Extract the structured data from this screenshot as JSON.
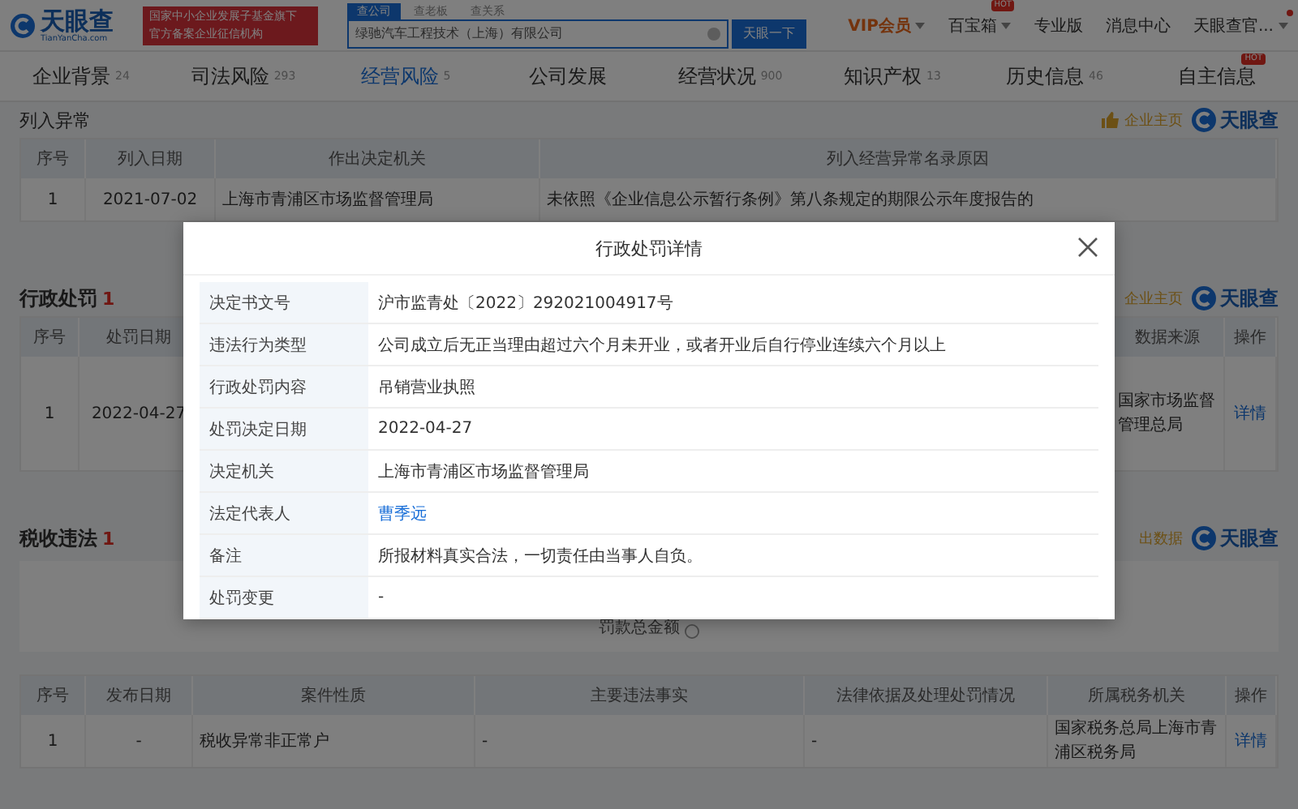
{
  "header": {
    "logo_text": "天眼查",
    "logo_domain": "TianYanCha.com",
    "banner_lines": [
      "国家中小企业发展子基金旗下",
      "官方备案企业征信机构"
    ],
    "search_tabs": [
      {
        "label": "查公司",
        "selected": true
      },
      {
        "label": "查老板",
        "selected": false
      },
      {
        "label": "查关系",
        "selected": false
      }
    ],
    "search_value": "绿驰汽车工程技术（上海）有限公司",
    "search_button": "天眼一下",
    "nav": [
      {
        "label": "VIP会员",
        "kind": "vip",
        "caret": true,
        "dot": false
      },
      {
        "label": "百宝箱",
        "kind": "plain",
        "caret": true,
        "badge": "HOT",
        "dot": false
      },
      {
        "label": "专业版",
        "kind": "plain",
        "caret": false,
        "dot": false
      },
      {
        "label": "消息中心",
        "kind": "plain",
        "caret": false,
        "dot": false
      },
      {
        "label": "天眼查官...",
        "kind": "plain",
        "caret": true,
        "dot": true
      }
    ]
  },
  "tabs": [
    {
      "label": "企业背景",
      "count": "24",
      "selected": false
    },
    {
      "label": "司法风险",
      "count": "293",
      "selected": false
    },
    {
      "label": "经营风险",
      "count": "5",
      "selected": true
    },
    {
      "label": "公司发展",
      "selected": false
    },
    {
      "label": "经营状况",
      "count": "900",
      "selected": false
    },
    {
      "label": "知识产权",
      "count": "13",
      "selected": false
    },
    {
      "label": "历史信息",
      "count": "46",
      "selected": false
    },
    {
      "label": "自主信息",
      "badge": "HOT",
      "selected": false
    }
  ],
  "sections": [
    {
      "title": "列入异常",
      "tool": {
        "kind": "like",
        "label": "企业主页"
      },
      "brand": "天眼查",
      "table": {
        "action_column": false,
        "columns": [
          "序号",
          "列入日期",
          "作出决定机关",
          "列入经营异常名录原因"
        ],
        "rows": [
          [
            "1",
            "2021-07-02",
            "上海市青浦区市场监督管理局",
            "未依照《企业信息公示暂行条例》第八条规定的期限公示年度报告的"
          ]
        ]
      }
    },
    {
      "title": "行政处罚",
      "count": "1",
      "tool": {
        "kind": "plain",
        "label": "企业主页"
      },
      "brand": "天眼查",
      "table": {
        "action_column": true,
        "columns": [
          "序号",
          "处罚日期",
          "数据来源",
          "操作"
        ],
        "rows": [
          [
            "1",
            "2022-04-27",
            "国家市场监督管理总局",
            "详情"
          ]
        ]
      }
    },
    {
      "title": "税收违法",
      "count": "1",
      "tool": {
        "kind": "plain",
        "label": "出数据"
      },
      "brand": "天眼查",
      "summary": "罚款总金额",
      "table": {
        "action_column": true,
        "columns": [
          "序号",
          "发布日期",
          "案件性质",
          "主要违法事实",
          "法律依据及处理处罚情况",
          "所属税务机关",
          "操作"
        ],
        "rows": [
          [
            "1",
            "-",
            "税收异常非正常户",
            "-",
            "-",
            "国家税务总局上海市青浦区税务局",
            "详情"
          ]
        ]
      }
    }
  ],
  "modal": {
    "title": "行政处罚详情",
    "rows": [
      {
        "label": "决定书文号",
        "value": "沪市监青处〔2022〕292021004917号",
        "kind": "text"
      },
      {
        "label": "违法行为类型",
        "value": "公司成立后无正当理由超过六个月未开业，或者开业后自行停业连续六个月以上",
        "kind": "text"
      },
      {
        "label": "行政处罚内容",
        "value": "吊销营业执照",
        "kind": "text"
      },
      {
        "label": "处罚决定日期",
        "value": "2022-04-27",
        "kind": "text"
      },
      {
        "label": "决定机关",
        "value": "上海市青浦区市场监督管理局",
        "kind": "text"
      },
      {
        "label": "法定代表人",
        "value": "曹季远",
        "kind": "link"
      },
      {
        "label": "备注",
        "value": "所报材料真实合法，一切责任由当事人自负。",
        "kind": "text"
      },
      {
        "label": "处罚变更",
        "value": "-",
        "kind": "text"
      }
    ]
  }
}
